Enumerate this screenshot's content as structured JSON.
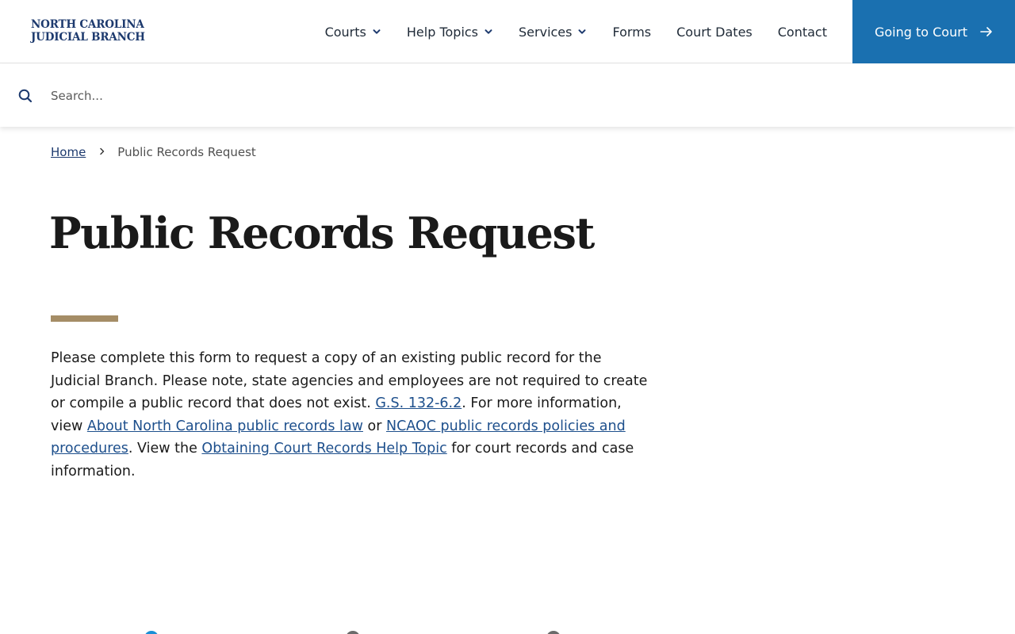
{
  "header": {
    "logo_line1": "NORTH CAROLINA",
    "logo_line2": "JUDICIAL BRANCH",
    "nav": [
      {
        "label": "Courts",
        "has_dropdown": true
      },
      {
        "label": "Help Topics",
        "has_dropdown": true
      },
      {
        "label": "Services",
        "has_dropdown": true
      },
      {
        "label": "Forms",
        "has_dropdown": false
      },
      {
        "label": "Court Dates",
        "has_dropdown": false
      },
      {
        "label": "Contact",
        "has_dropdown": false
      }
    ],
    "cta_label": "Going to Court"
  },
  "search": {
    "placeholder": "Search...",
    "value": ""
  },
  "breadcrumb": {
    "home": "Home",
    "current": "Public Records Request"
  },
  "page": {
    "title": "Public Records Request",
    "intro": {
      "t1": "Please complete this form to request a copy of an existing public record for the Judicial Branch. Please note, state agencies and employees are not required to create or compile a public record that does not exist. ",
      "link1": "G.S. 132-6.2",
      "t2": ". For more information, view ",
      "link2": "About North Carolina public records law",
      "t3": " or ",
      "link3": "NCAOC public records policies and procedures",
      "t4": ". View the ",
      "link4": "Obtaining Court Records Help Topic",
      "t5": " for court records and case information."
    }
  },
  "colors": {
    "brand_navy": "#1d3a6e",
    "cta_blue": "#1a70b0",
    "accent_gold": "#a58d66",
    "link_blue": "#1d4f8c",
    "step_active": "#1a8fd6",
    "step_inactive": "#6b6b6b"
  }
}
